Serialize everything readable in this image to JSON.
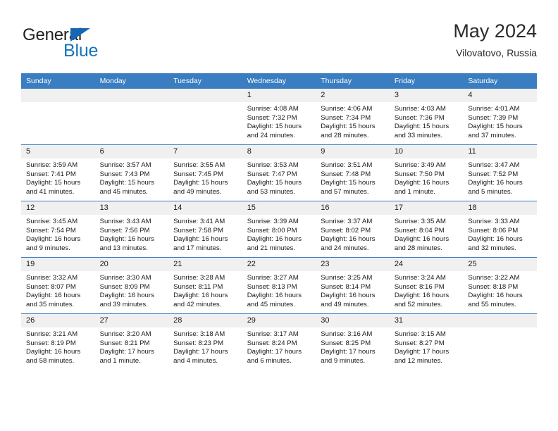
{
  "brand": {
    "name_part1": "General",
    "name_part2": "Blue",
    "accent_color": "#1473bb",
    "header_color": "#3a7dc0"
  },
  "header": {
    "title": "May 2024",
    "subtitle": "Vilovatovo, Russia"
  },
  "weekdays": [
    "Sunday",
    "Monday",
    "Tuesday",
    "Wednesday",
    "Thursday",
    "Friday",
    "Saturday"
  ],
  "weeks": [
    [
      {
        "day": "",
        "sunrise": "",
        "sunset": "",
        "daylight": "",
        "blank": true
      },
      {
        "day": "",
        "sunrise": "",
        "sunset": "",
        "daylight": "",
        "blank": true
      },
      {
        "day": "",
        "sunrise": "",
        "sunset": "",
        "daylight": "",
        "blank": true
      },
      {
        "day": "1",
        "sunrise": "Sunrise: 4:08 AM",
        "sunset": "Sunset: 7:32 PM",
        "daylight": "Daylight: 15 hours and 24 minutes."
      },
      {
        "day": "2",
        "sunrise": "Sunrise: 4:06 AM",
        "sunset": "Sunset: 7:34 PM",
        "daylight": "Daylight: 15 hours and 28 minutes."
      },
      {
        "day": "3",
        "sunrise": "Sunrise: 4:03 AM",
        "sunset": "Sunset: 7:36 PM",
        "daylight": "Daylight: 15 hours and 33 minutes."
      },
      {
        "day": "4",
        "sunrise": "Sunrise: 4:01 AM",
        "sunset": "Sunset: 7:39 PM",
        "daylight": "Daylight: 15 hours and 37 minutes."
      }
    ],
    [
      {
        "day": "5",
        "sunrise": "Sunrise: 3:59 AM",
        "sunset": "Sunset: 7:41 PM",
        "daylight": "Daylight: 15 hours and 41 minutes."
      },
      {
        "day": "6",
        "sunrise": "Sunrise: 3:57 AM",
        "sunset": "Sunset: 7:43 PM",
        "daylight": "Daylight: 15 hours and 45 minutes."
      },
      {
        "day": "7",
        "sunrise": "Sunrise: 3:55 AM",
        "sunset": "Sunset: 7:45 PM",
        "daylight": "Daylight: 15 hours and 49 minutes."
      },
      {
        "day": "8",
        "sunrise": "Sunrise: 3:53 AM",
        "sunset": "Sunset: 7:47 PM",
        "daylight": "Daylight: 15 hours and 53 minutes."
      },
      {
        "day": "9",
        "sunrise": "Sunrise: 3:51 AM",
        "sunset": "Sunset: 7:48 PM",
        "daylight": "Daylight: 15 hours and 57 minutes."
      },
      {
        "day": "10",
        "sunrise": "Sunrise: 3:49 AM",
        "sunset": "Sunset: 7:50 PM",
        "daylight": "Daylight: 16 hours and 1 minute."
      },
      {
        "day": "11",
        "sunrise": "Sunrise: 3:47 AM",
        "sunset": "Sunset: 7:52 PM",
        "daylight": "Daylight: 16 hours and 5 minutes."
      }
    ],
    [
      {
        "day": "12",
        "sunrise": "Sunrise: 3:45 AM",
        "sunset": "Sunset: 7:54 PM",
        "daylight": "Daylight: 16 hours and 9 minutes."
      },
      {
        "day": "13",
        "sunrise": "Sunrise: 3:43 AM",
        "sunset": "Sunset: 7:56 PM",
        "daylight": "Daylight: 16 hours and 13 minutes."
      },
      {
        "day": "14",
        "sunrise": "Sunrise: 3:41 AM",
        "sunset": "Sunset: 7:58 PM",
        "daylight": "Daylight: 16 hours and 17 minutes."
      },
      {
        "day": "15",
        "sunrise": "Sunrise: 3:39 AM",
        "sunset": "Sunset: 8:00 PM",
        "daylight": "Daylight: 16 hours and 21 minutes."
      },
      {
        "day": "16",
        "sunrise": "Sunrise: 3:37 AM",
        "sunset": "Sunset: 8:02 PM",
        "daylight": "Daylight: 16 hours and 24 minutes."
      },
      {
        "day": "17",
        "sunrise": "Sunrise: 3:35 AM",
        "sunset": "Sunset: 8:04 PM",
        "daylight": "Daylight: 16 hours and 28 minutes."
      },
      {
        "day": "18",
        "sunrise": "Sunrise: 3:33 AM",
        "sunset": "Sunset: 8:06 PM",
        "daylight": "Daylight: 16 hours and 32 minutes."
      }
    ],
    [
      {
        "day": "19",
        "sunrise": "Sunrise: 3:32 AM",
        "sunset": "Sunset: 8:07 PM",
        "daylight": "Daylight: 16 hours and 35 minutes."
      },
      {
        "day": "20",
        "sunrise": "Sunrise: 3:30 AM",
        "sunset": "Sunset: 8:09 PM",
        "daylight": "Daylight: 16 hours and 39 minutes."
      },
      {
        "day": "21",
        "sunrise": "Sunrise: 3:28 AM",
        "sunset": "Sunset: 8:11 PM",
        "daylight": "Daylight: 16 hours and 42 minutes."
      },
      {
        "day": "22",
        "sunrise": "Sunrise: 3:27 AM",
        "sunset": "Sunset: 8:13 PM",
        "daylight": "Daylight: 16 hours and 45 minutes."
      },
      {
        "day": "23",
        "sunrise": "Sunrise: 3:25 AM",
        "sunset": "Sunset: 8:14 PM",
        "daylight": "Daylight: 16 hours and 49 minutes."
      },
      {
        "day": "24",
        "sunrise": "Sunrise: 3:24 AM",
        "sunset": "Sunset: 8:16 PM",
        "daylight": "Daylight: 16 hours and 52 minutes."
      },
      {
        "day": "25",
        "sunrise": "Sunrise: 3:22 AM",
        "sunset": "Sunset: 8:18 PM",
        "daylight": "Daylight: 16 hours and 55 minutes."
      }
    ],
    [
      {
        "day": "26",
        "sunrise": "Sunrise: 3:21 AM",
        "sunset": "Sunset: 8:19 PM",
        "daylight": "Daylight: 16 hours and 58 minutes."
      },
      {
        "day": "27",
        "sunrise": "Sunrise: 3:20 AM",
        "sunset": "Sunset: 8:21 PM",
        "daylight": "Daylight: 17 hours and 1 minute."
      },
      {
        "day": "28",
        "sunrise": "Sunrise: 3:18 AM",
        "sunset": "Sunset: 8:23 PM",
        "daylight": "Daylight: 17 hours and 4 minutes."
      },
      {
        "day": "29",
        "sunrise": "Sunrise: 3:17 AM",
        "sunset": "Sunset: 8:24 PM",
        "daylight": "Daylight: 17 hours and 6 minutes."
      },
      {
        "day": "30",
        "sunrise": "Sunrise: 3:16 AM",
        "sunset": "Sunset: 8:25 PM",
        "daylight": "Daylight: 17 hours and 9 minutes."
      },
      {
        "day": "31",
        "sunrise": "Sunrise: 3:15 AM",
        "sunset": "Sunset: 8:27 PM",
        "daylight": "Daylight: 17 hours and 12 minutes."
      },
      {
        "day": "",
        "sunrise": "",
        "sunset": "",
        "daylight": "",
        "blank": true
      }
    ]
  ]
}
